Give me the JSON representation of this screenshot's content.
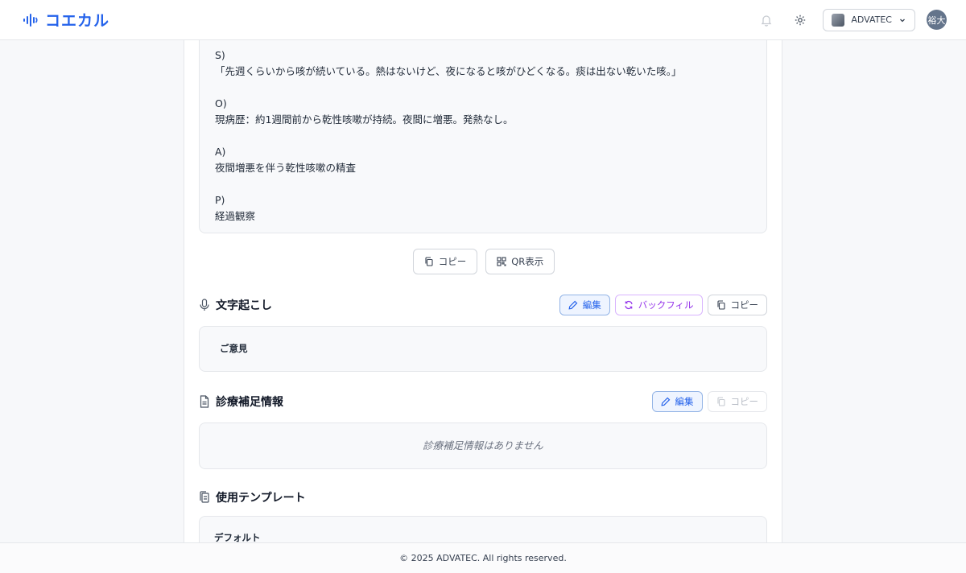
{
  "header": {
    "brand_name": "コエカル",
    "org_name": "ADVATEC",
    "avatar_text": "裕大",
    "icons": [
      "waveform-logo-icon",
      "bell-icon",
      "gear-icon",
      "chevron-down-icon"
    ]
  },
  "soap": {
    "s_label": "S)",
    "s_text": "「先週くらいから咳が続いている。熱はないけど、夜になると咳がひどくなる。痰は出ない乾いた咳。」",
    "o_label": "O)",
    "o_text": "現病歴：約1週間前から乾性咳嗽が持続。夜間に増悪。発熱なし。",
    "a_label": "A)",
    "a_text": "夜間増悪を伴う乾性咳嗽の精査",
    "p_label": "P)",
    "p_text": "経過観察",
    "copy_label": "コピー",
    "qr_label": "QR表示"
  },
  "transcription": {
    "title": "文字起こし",
    "edit_label": "編集",
    "backfill_label": "バックフィル",
    "copy_label": "コピー",
    "text": "ご意見"
  },
  "supplement": {
    "title": "診療補足情報",
    "edit_label": "編集",
    "copy_label": "コピー",
    "empty_text": "診療補足情報はありません"
  },
  "template": {
    "title": "使用テンプレート",
    "name": "デフォルト"
  },
  "footer": {
    "copyright": "© 2025 ADVATEC. All rights reserved."
  },
  "colors": {
    "brand": "#2563eb",
    "backfill": "#9333ea",
    "avatar": "#64748b"
  }
}
